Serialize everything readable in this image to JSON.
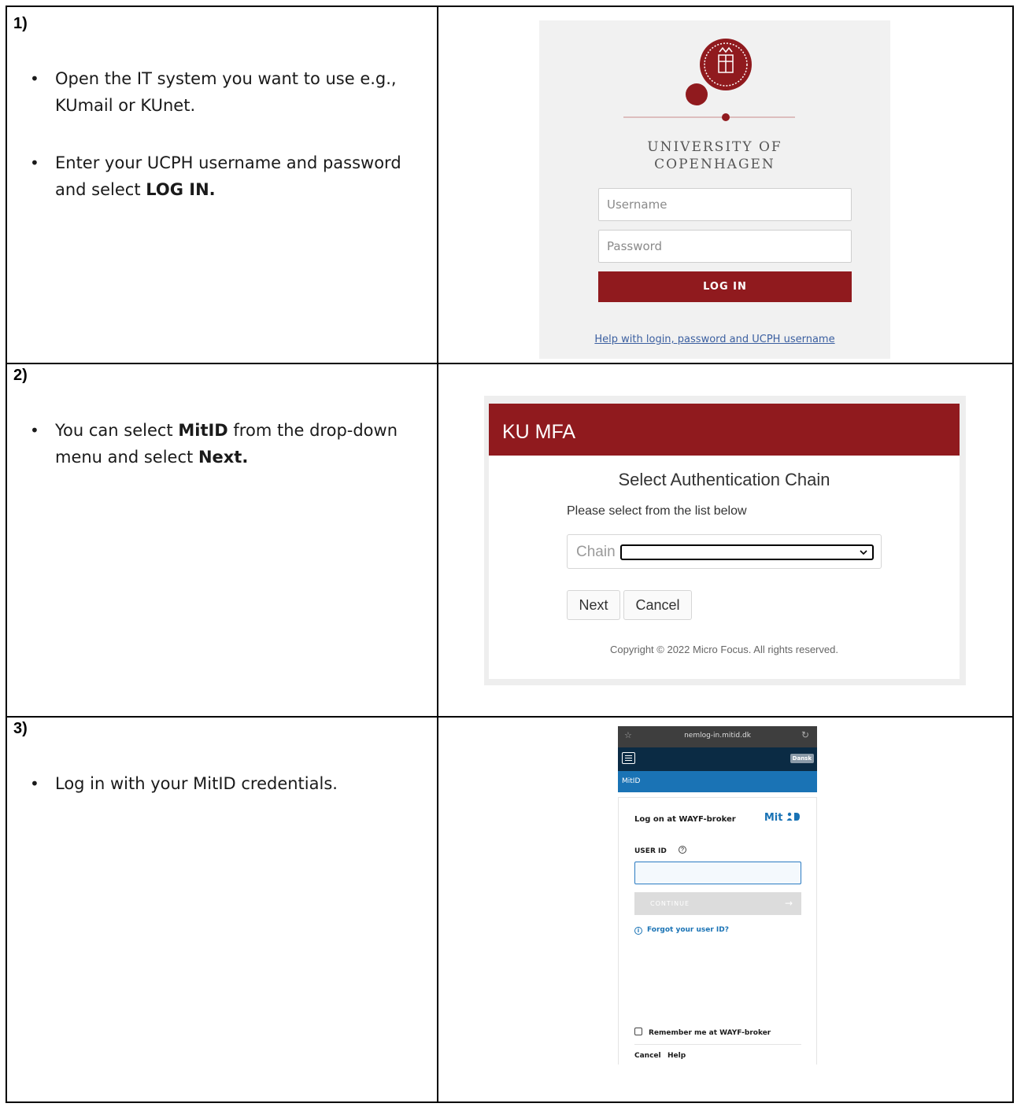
{
  "steps": [
    {
      "number": "1)",
      "bullets": [
        {
          "text": "Open the IT system you want to use e.g., KUmail or KUnet."
        },
        {
          "text_before": "Enter your UCPH username and password and select ",
          "bold": "LOG IN."
        }
      ]
    },
    {
      "number": "2)",
      "bullets": [
        {
          "text_before": "You can select ",
          "bold": "MitID",
          "text_middle": " from the drop-down menu and select ",
          "bold2": "Next."
        }
      ]
    },
    {
      "number": "3)",
      "bullets": [
        {
          "text": "Log in with your MitID credentials."
        }
      ]
    }
  ],
  "ucph_login": {
    "brand_line1": "UNIVERSITY OF",
    "brand_line2": "COPENHAGEN",
    "username_placeholder": "Username",
    "password_placeholder": "Password",
    "login_button": "LOG IN",
    "help_link": "Help with login, password and UCPH username",
    "brand_color": "#901a1e"
  },
  "ku_mfa": {
    "header": "KU MFA",
    "title": "Select Authentication Chain",
    "subtitle": "Please select from the list below",
    "chain_label": "Chain",
    "chain_value": "",
    "next_button": "Next",
    "cancel_button": "Cancel",
    "copyright": "Copyright © 2022 Micro Focus. All rights reserved."
  },
  "mitid": {
    "url": "nemlog-in.mitid.dk",
    "language_button": "Dansk",
    "bar_label": "MitID",
    "form_title": "Log on at WAYF-broker",
    "logo_text": "Mit",
    "user_id_label": "USER ID",
    "continue_button": "CONTINUE",
    "forgot_link": "Forgot your user ID?",
    "remember_label": "Remember me at WAYF-broker",
    "cancel_link": "Cancel",
    "help_link": "Help",
    "accent_color": "#1a73b5",
    "nav_color": "#0b2b44"
  }
}
